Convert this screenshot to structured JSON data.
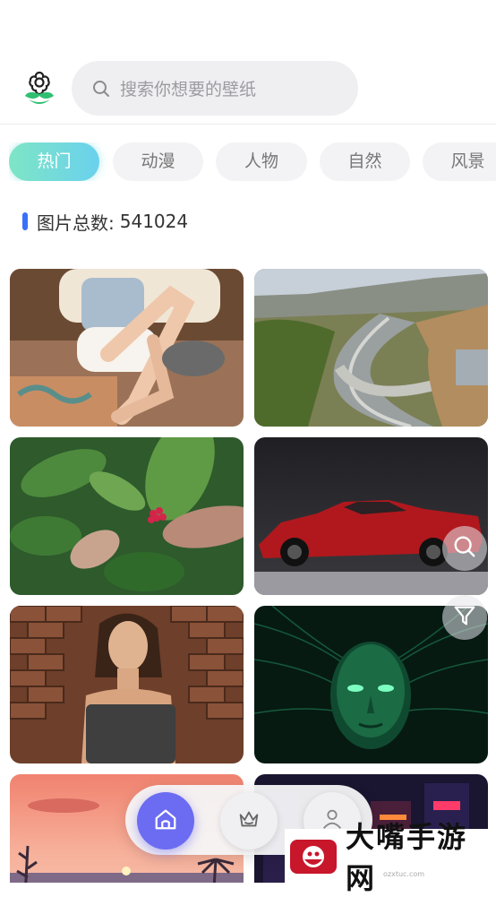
{
  "header": {
    "logo_icon": "flower-sprout-icon",
    "search": {
      "placeholder": "搜索你想要的壁纸",
      "icon": "search-icon"
    }
  },
  "tabs": [
    {
      "label": "热门",
      "active": true
    },
    {
      "label": "动漫",
      "active": false
    },
    {
      "label": "人物",
      "active": false
    },
    {
      "label": "自然",
      "active": false
    },
    {
      "label": "风景",
      "active": false
    }
  ],
  "stats": {
    "label": "图片总数:",
    "value": "541024"
  },
  "wallpapers": [
    {
      "subject": "woman-sitting-on-chair"
    },
    {
      "subject": "highway-interchange-aerial"
    },
    {
      "subject": "green-leaves-red-berries"
    },
    {
      "subject": "red-sports-car"
    },
    {
      "subject": "woman-brick-wall"
    },
    {
      "subject": "green-digital-face"
    },
    {
      "subject": "sunset-beach"
    },
    {
      "subject": "neon-city"
    }
  ],
  "floating_buttons": {
    "zoom_icon": "zoom-icon",
    "filter_icon": "filter-icon"
  },
  "bottom_nav": [
    {
      "icon": "home-icon",
      "active": true
    },
    {
      "icon": "crown-icon",
      "active": false
    },
    {
      "icon": "user-icon",
      "active": false
    }
  ],
  "watermark": {
    "text": "大嘴手游网",
    "sub": "ozxtuc.com"
  },
  "colors": {
    "accent": "#6b6cf2",
    "tab_gradient_start": "#7ee5c5",
    "tab_gradient_end": "#6ad1ee",
    "count_bar": "#3a6ff7"
  }
}
